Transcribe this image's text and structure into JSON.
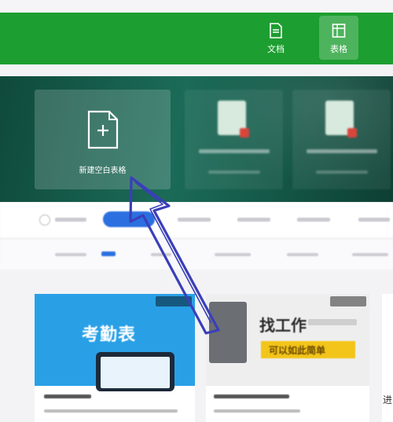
{
  "header": {
    "doc_button_label": "文档",
    "sheet_button_label": "表格",
    "background": "#1d9e30"
  },
  "hero": {
    "new_blank_label": "新建空白表格"
  },
  "cards": {
    "card_a_title": "考勤表",
    "card_b_title": "找工作",
    "card_b_banner_text": "可以如此简单"
  },
  "partial": {
    "right_edge_char": "进"
  },
  "icons": {
    "doc": "document-icon",
    "sheet": "table-icon",
    "new": "new-file-plus-icon",
    "annotation": "arrow-annotation"
  }
}
